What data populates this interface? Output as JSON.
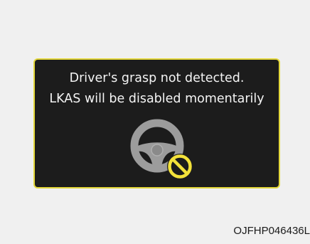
{
  "warning": {
    "line1": "Driver's grasp not detected.",
    "line2": "LKAS will be disabled momentarily",
    "icon": "steering-wheel-icon",
    "prohibited_icon": "prohibited-icon"
  },
  "figure_code": "OJFHP046436L",
  "colors": {
    "panel_background": "#1c1c1c",
    "panel_border": "#e3d73a",
    "text": "#f4f4f4",
    "prohibited_sign": "#f3e23a"
  }
}
